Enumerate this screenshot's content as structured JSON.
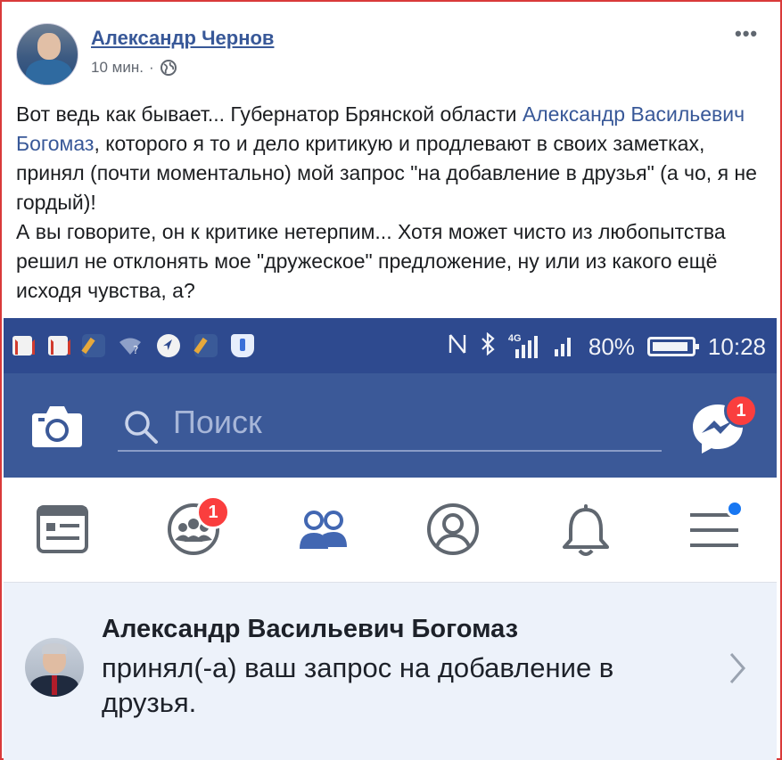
{
  "post": {
    "author": "Александр Чернов",
    "time": "10 мин.",
    "separator": "·",
    "more": "•••",
    "text_part1": "Вот ведь как бывает... Губернатор Брянской области ",
    "mention": "Александр Васильевич Богомаз",
    "text_part2": ", которого я то и дело критикую и продлевают в своих заметках, принял (почти моментально) мой запрос \"на добавление в друзья\" (а чо, я не гордый)!",
    "text_line2": "А вы говорите, он к критике нетерпим... Хотя может чисто из любопытства решил не отклонять мое \"дружеское\" предложение, ну или из какого ещё исходя чувства, а?"
  },
  "phone": {
    "status_bar": {
      "left_icons": [
        "gmail-icon",
        "gmail-icon",
        "broom-icon",
        "wifi-question-icon",
        "navigation-icon",
        "broom-icon",
        "shield-icon"
      ],
      "network": "4G",
      "battery": "80%",
      "time": "10:28"
    },
    "search": {
      "placeholder": "Поиск"
    },
    "messenger_badge": "1",
    "tabs": [
      {
        "icon": "news-feed-icon"
      },
      {
        "icon": "groups-icon",
        "badge": "1"
      },
      {
        "icon": "friends-icon"
      },
      {
        "icon": "profile-icon"
      },
      {
        "icon": "bell-icon"
      },
      {
        "icon": "menu-icon"
      }
    ],
    "notification": {
      "name": "Александр Васильевич Богомаз",
      "message": "принял(-а) ваш запрос на добавление в друзья."
    }
  },
  "colors": {
    "facebook_blue": "#3b5998",
    "status_bar": "#2e4a8f",
    "link": "#385898",
    "badge_red": "#fa3e3e",
    "notification_bg": "#edf2fa",
    "frame_border": "#d93a3a"
  }
}
